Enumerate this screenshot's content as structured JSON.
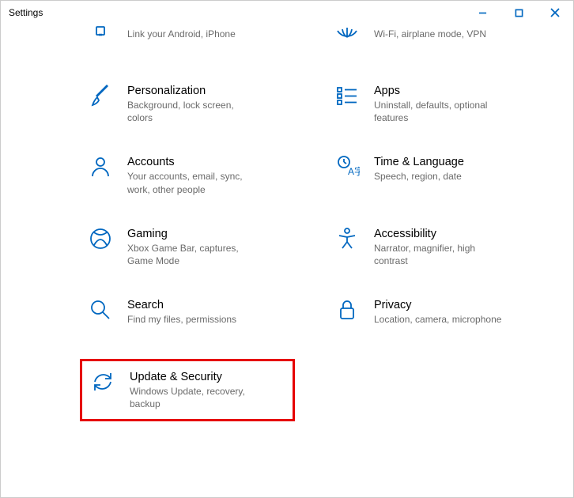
{
  "window": {
    "title": "Settings"
  },
  "tiles": {
    "phone": {
      "title": "",
      "desc": "Link your Android, iPhone"
    },
    "network": {
      "title": "",
      "desc": "Wi-Fi, airplane mode, VPN"
    },
    "personalization": {
      "title": "Personalization",
      "desc": "Background, lock screen, colors"
    },
    "apps": {
      "title": "Apps",
      "desc": "Uninstall, defaults, optional features"
    },
    "accounts": {
      "title": "Accounts",
      "desc": "Your accounts, email, sync, work, other people"
    },
    "time": {
      "title": "Time & Language",
      "desc": "Speech, region, date"
    },
    "gaming": {
      "title": "Gaming",
      "desc": "Xbox Game Bar, captures, Game Mode"
    },
    "accessibility": {
      "title": "Accessibility",
      "desc": "Narrator, magnifier, high contrast"
    },
    "search": {
      "title": "Search",
      "desc": "Find my files, permissions"
    },
    "privacy": {
      "title": "Privacy",
      "desc": "Location, camera, microphone"
    },
    "update": {
      "title": "Update & Security",
      "desc": "Windows Update, recovery, backup"
    }
  },
  "colors": {
    "accent": "#0067c0",
    "highlight": "#e60000"
  }
}
